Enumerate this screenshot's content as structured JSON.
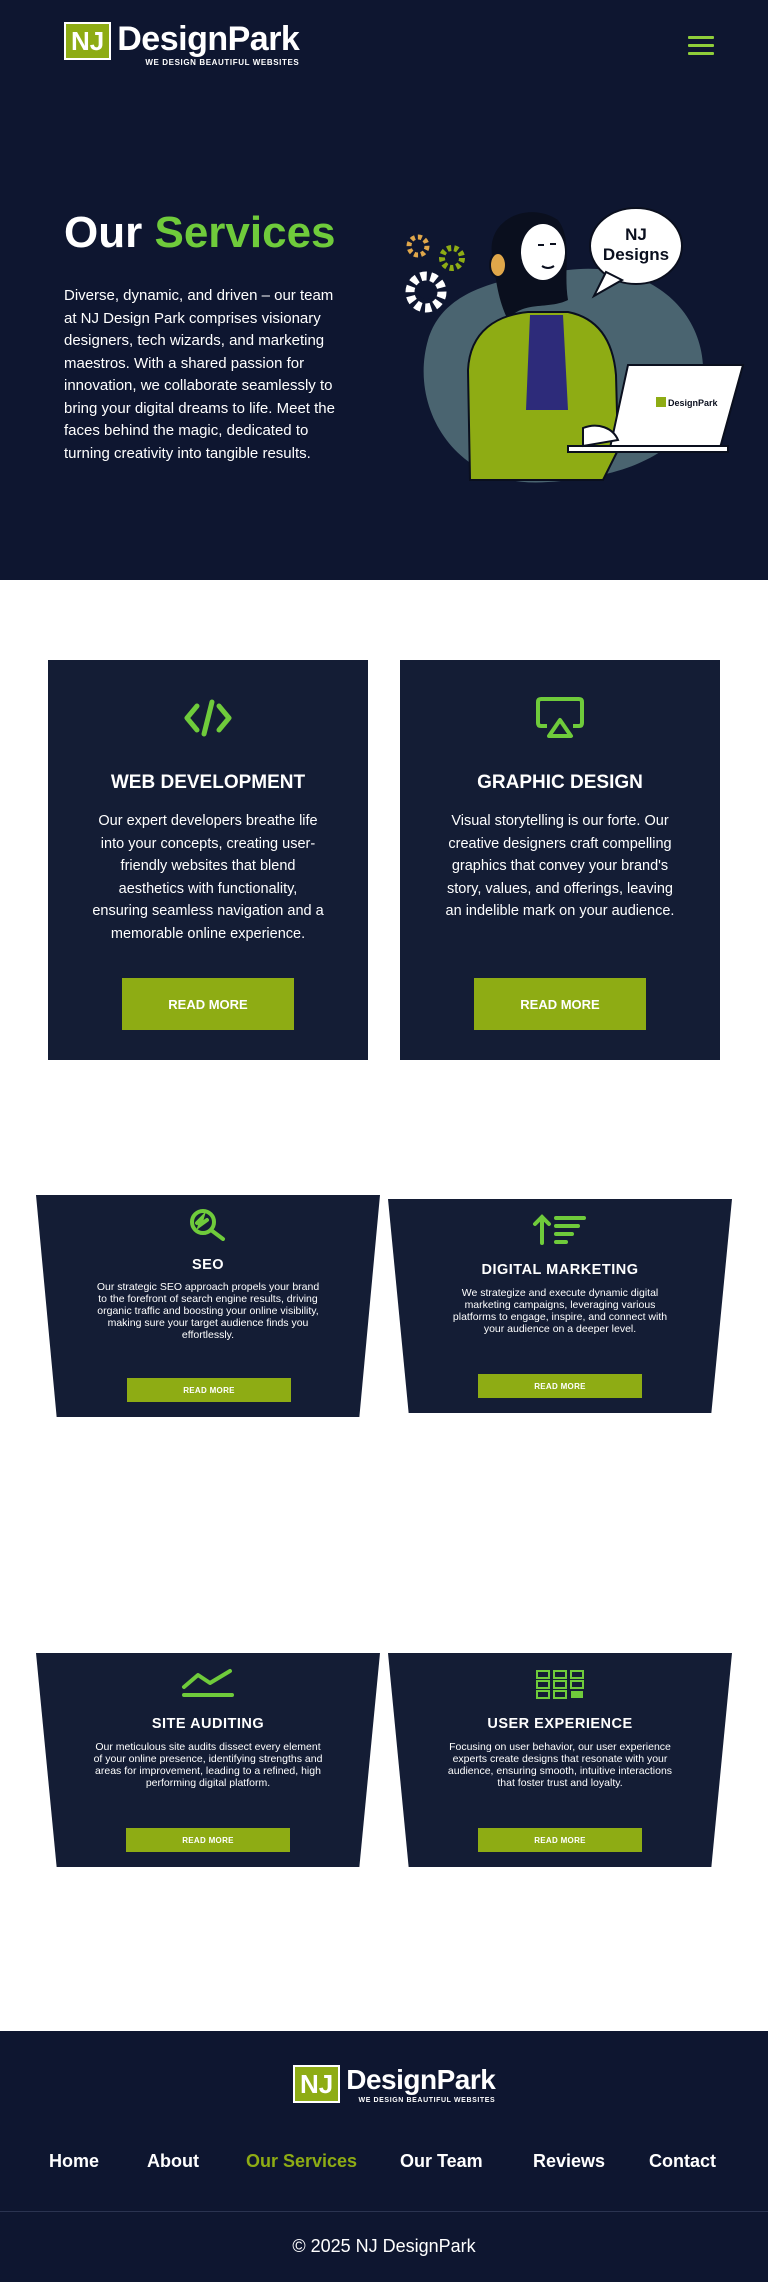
{
  "header": {
    "logo": {
      "initials": "NJ",
      "name": "DesignPark",
      "tagline": "WE DESIGN BEAUTIFUL WEBSITES"
    },
    "menu_icon": "hamburger-menu-icon"
  },
  "hero": {
    "title_plain": "Our",
    "title_accent": "Services",
    "text": "Diverse, dynamic, and driven – our team at NJ Design Park comprises visionary designers, tech wizards, and marketing maestros. With a shared passion for innovation, we collaborate seamlessly to bring your digital dreams to life. Meet the faces behind the magic, dedicated to turning creativity into tangible results.",
    "bubble_line1": "NJ",
    "bubble_line2": "Designs",
    "laptop_logo_initials": "NJ",
    "laptop_logo_name": "DesignPark"
  },
  "services": [
    {
      "icon": "code-icon",
      "title": "WEB DEVELOPMENT",
      "text": "Our expert developers breathe life into your concepts, creating user-friendly websites that blend aesthetics with functionality, ensuring seamless navigation and a memorable online experience.",
      "button": "READ MORE"
    },
    {
      "icon": "airplay-icon",
      "title": "GRAPHIC DESIGN",
      "text": "Visual storytelling is our forte. Our creative designers craft compelling graphics that convey your brand's story, values, and offerings, leaving an indelible mark on your audience.",
      "button": "READ MORE"
    },
    {
      "icon": "seo-magnifier-icon",
      "title": "SEO",
      "text": "Our strategic SEO approach propels your brand to the forefront of search engine results, driving organic traffic and boosting your online visibility, making sure your target audience finds you effortlessly.",
      "button": "READ MORE"
    },
    {
      "icon": "sort-up-icon",
      "title": "DIGITAL MARKETING",
      "text": "We strategize and execute dynamic digital marketing campaigns, leveraging various platforms to engage, inspire, and connect with your audience on a deeper level.",
      "button": "READ MORE"
    },
    {
      "icon": "trend-line-icon",
      "title": "SITE AUDITING",
      "text": "Our meticulous site audits dissect every element of your online presence, identifying strengths and areas for improvement, leading to a refined, high performing digital platform.",
      "button": "READ MORE"
    },
    {
      "icon": "grid-layout-icon",
      "title": "USER EXPERIENCE",
      "text": "Focusing on user behavior, our user experience experts create designs that resonate with your audience, ensuring smooth, intuitive interactions that foster trust and loyalty.",
      "button": "READ MORE"
    }
  ],
  "footer": {
    "logo": {
      "initials": "NJ",
      "name": "DesignPark",
      "tagline": "WE DESIGN BEAUTIFUL WEBSITES"
    },
    "nav": [
      {
        "label": "Home"
      },
      {
        "label": "About"
      },
      {
        "label": "Our Services",
        "active": true
      },
      {
        "label": "Our Team"
      },
      {
        "label": "Reviews"
      },
      {
        "label": "Contact"
      }
    ],
    "copyright": "© 2025 NJ DesignPark"
  },
  "colors": {
    "navy": "#0e1630",
    "card": "#141d35",
    "olive": "#8eac14",
    "green_accent": "#6fcb3b"
  }
}
